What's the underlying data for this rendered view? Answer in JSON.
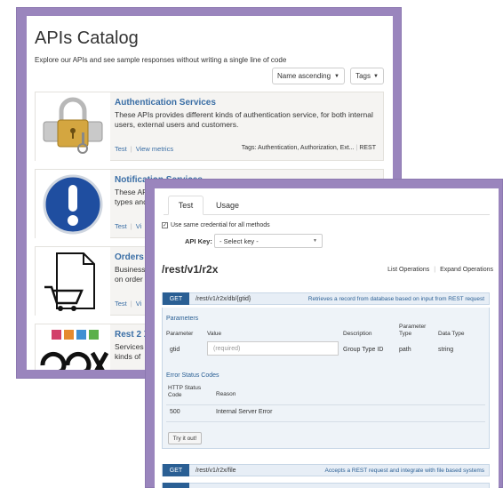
{
  "catalog": {
    "title": "APIs Catalog",
    "subtitle": "Explore our APIs and see sample responses without writing a single line of code",
    "sort_label": "Name ascending",
    "tags_label": "Tags",
    "cards": [
      {
        "title": "Authentication Services",
        "description": "These APIs provides different kinds of authentication service, for both internal users, external users and customers.",
        "test": "Test",
        "view_metrics": "View metrics",
        "tags": "Tags: Authentication, Authorization, Ext...",
        "type": "REST"
      },
      {
        "title": "Notification Services",
        "description": "These AP",
        "description2": "types and",
        "test": "Test",
        "view_metrics": "Vi"
      },
      {
        "title": "Orders",
        "description": "Business",
        "description2": "on order",
        "test": "Test",
        "view_metrics": "Vi"
      },
      {
        "title": "Rest 2 X",
        "description": "Services",
        "description2": "kinds of"
      }
    ]
  },
  "console": {
    "tabs": [
      "Test",
      "Usage"
    ],
    "same_credential": "Use same credential for all methods",
    "api_key_label": "API Key:",
    "api_key_value": "- Select key -",
    "resource_path": "/rest/v1/r2x",
    "list_operations": "List Operations",
    "expand_operations": "Expand Operations",
    "operations": [
      {
        "method": "GET",
        "path": "/rest/v1/r2x/db/{gtid}",
        "description": "Retrieves a record from database based on input from REST request"
      },
      {
        "method": "GET",
        "path": "/rest/v1/r2x/file",
        "description": "Accepts a REST request and integrate with file based systems"
      }
    ],
    "parameters_heading": "Parameters",
    "param_headers": {
      "parameter": "Parameter",
      "value": "Value",
      "description": "Description",
      "parameter_type": "Parameter Type",
      "data_type": "Data Type"
    },
    "param_row": {
      "name": "gtid",
      "placeholder": "(required)",
      "description": "Group Type ID",
      "type": "path",
      "data_type": "string"
    },
    "error_heading": "Error Status Codes",
    "error_headers": {
      "code": "HTTP Status Code",
      "reason": "Reason"
    },
    "error_row": {
      "code": "500",
      "reason": "Internal Server Error"
    },
    "try_button": "Try it out!"
  },
  "colors": {
    "frame": "#9a85bd",
    "link": "#3a6ea5",
    "method": "#2a5f94"
  }
}
